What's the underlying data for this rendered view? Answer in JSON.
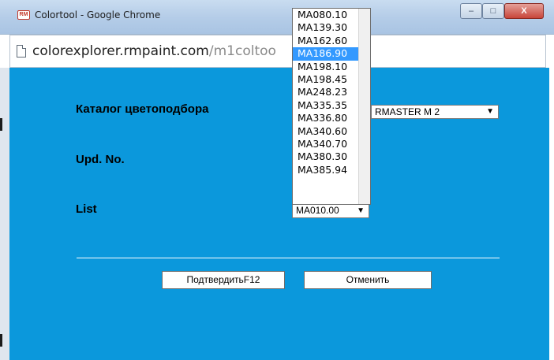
{
  "window": {
    "title": "Colortool - Google Chrome",
    "app_icon_text": "RM",
    "controls": {
      "minimize": "–",
      "maximize": "□",
      "close": "X"
    }
  },
  "address": {
    "url_domain": "colorexplorer.rmpaint.com",
    "url_path": "/m1coltoo"
  },
  "form": {
    "catalog_label": "Каталог цветоподбора",
    "catalog_value": "RMASTER M 2",
    "upd_label": "Upd. No.",
    "list_label": "List",
    "list_value": "MA010.00"
  },
  "buttons": {
    "confirm": "ПодтвердитьF12",
    "cancel": "Отменить"
  },
  "dropdown": {
    "items": [
      "MA080.10",
      "MA139.30",
      "MA162.60",
      "MA186.90",
      "MA198.10",
      "MA198.45",
      "MA248.23",
      "MA335.35",
      "MA336.80",
      "MA340.60",
      "MA340.70",
      "MA380.30",
      "MA385.94"
    ],
    "selected": "MA186.90"
  },
  "colors": {
    "content_bg": "#0b98dc",
    "selected_bg": "#3399ff",
    "close_button": "#c8453a"
  },
  "icons": {
    "caret": "▼"
  }
}
